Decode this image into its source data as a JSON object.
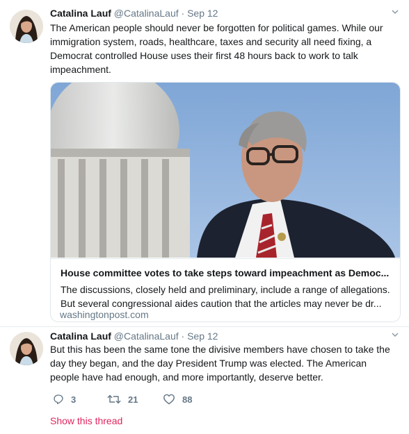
{
  "tweets": [
    {
      "name": "Catalina Lauf",
      "handle": "@CatalinaLauf",
      "separator": "·",
      "date": "Sep 12",
      "text": "The American people should never be forgotten for political games. While our immigration system, roads, healthcare, taxes and security all need fixing, a Democrat controlled House uses their first 48 hours back to work to talk impeachment.",
      "card": {
        "title": "House committee votes to take steps toward impeachment as Democ...",
        "description": "The discussions, closely held and preliminary, include a range of allegations. But several congressional aides caution that the articles may never be dr...",
        "domain": "washingtonpost.com"
      }
    },
    {
      "name": "Catalina Lauf",
      "handle": "@CatalinaLauf",
      "separator": "·",
      "date": "Sep 12",
      "text": "But this has been the same tone the divisive members have chosen to take the day they began, and the day President Trump was elected. The American people have had enough, and more importantly, deserve better.",
      "actions": {
        "replies": "3",
        "retweets": "21",
        "likes": "88"
      },
      "show_thread": "Show this thread"
    }
  ],
  "icons": {
    "caret": "chevron-down-icon",
    "reply": "reply-icon",
    "retweet": "retweet-icon",
    "like": "heart-icon"
  },
  "colors": {
    "text": "#14171a",
    "secondary": "#657786",
    "border": "#e6ecf0",
    "show_thread": "#e0245e"
  }
}
